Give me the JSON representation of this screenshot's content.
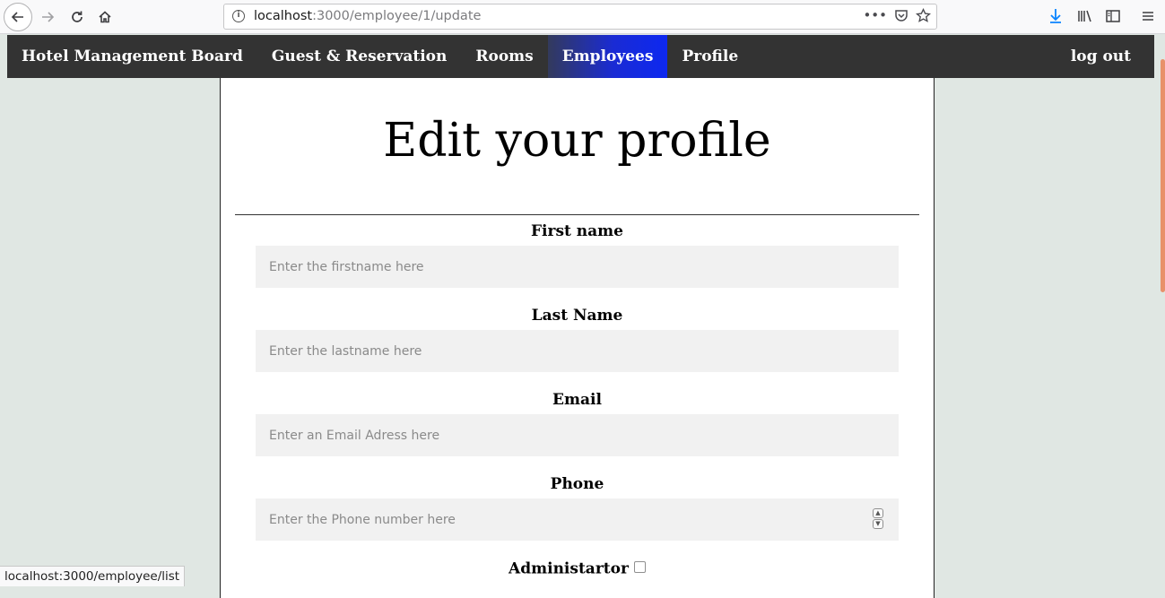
{
  "browser": {
    "url_host": "localhost",
    "url_path": ":3000/employee/1/update",
    "status_url": "localhost:3000/employee/list"
  },
  "nav": {
    "brand": "Hotel Management Board",
    "items": [
      {
        "label": "Guest & Reservation",
        "active": false
      },
      {
        "label": "Rooms",
        "active": false
      },
      {
        "label": "Employees",
        "active": true
      },
      {
        "label": "Profile",
        "active": false
      }
    ],
    "logout": "log out"
  },
  "page": {
    "title": "Edit your profile"
  },
  "form": {
    "first_name": {
      "label": "First name",
      "placeholder": "Enter the firstname here",
      "value": ""
    },
    "last_name": {
      "label": "Last Name",
      "placeholder": "Enter the lastname here",
      "value": ""
    },
    "email": {
      "label": "Email",
      "placeholder": "Enter an Email Adress here",
      "value": ""
    },
    "phone": {
      "label": "Phone",
      "placeholder": "Enter the Phone number here",
      "value": ""
    },
    "admin": {
      "label": "Administartor",
      "checked": false
    }
  },
  "colors": {
    "navbar_bg": "#333333",
    "active_tab": "#0d28f0",
    "page_bg": "#e0e7e3",
    "input_bg": "#f1f1f1"
  }
}
